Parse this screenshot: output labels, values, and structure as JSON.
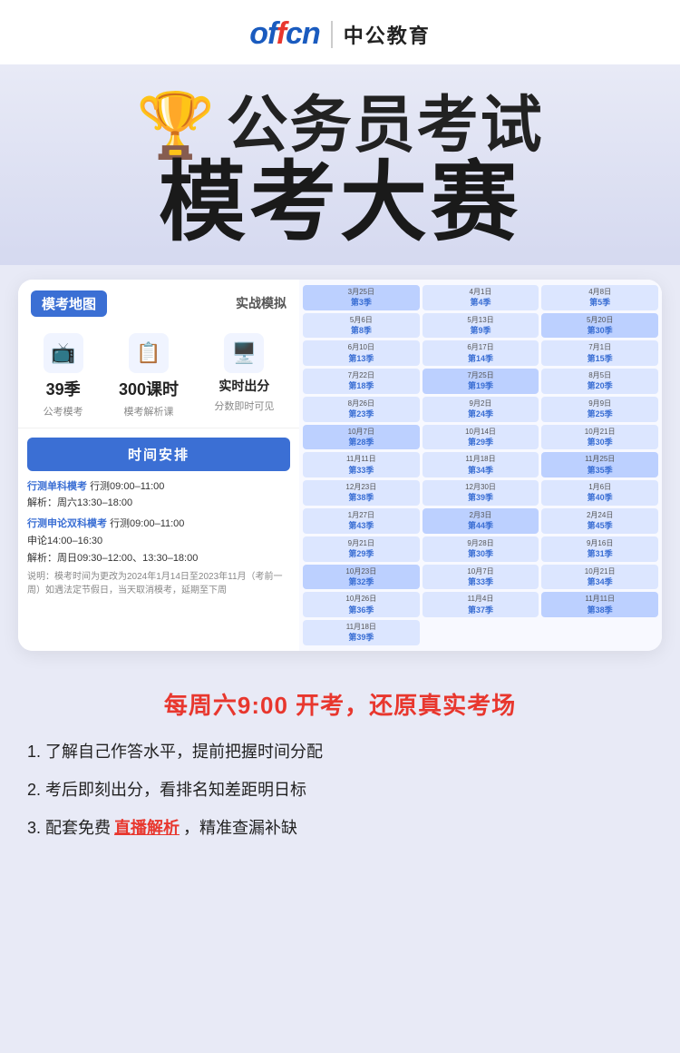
{
  "header": {
    "logo_offcn": "offcn",
    "logo_text": "中公教育"
  },
  "hero": {
    "trophy": "🏆",
    "title1": "公务员考试",
    "title2": "模考大赛"
  },
  "card": {
    "tag": "模考地图",
    "right_label": "实战模拟",
    "stats": [
      {
        "icon": "📺",
        "number": "39季",
        "label": "公考模考"
      },
      {
        "icon": "📋",
        "number": "300课时",
        "label": "模考解析课"
      },
      {
        "icon": "🖥️",
        "number": "实时出分",
        "label": "分数即时可见"
      }
    ],
    "schedule_btn": "时间安排",
    "schedule_items": [
      {
        "link": "行测单科模考",
        "times": "行测09:00–11:00",
        "parse": "解析：周六13:30–18:00"
      },
      {
        "link": "行测申论双科模考",
        "times": "行测09:00–11:00\n申论14:00–16:30",
        "parse": "解析：周日09:30–12:00、13:30–18:00"
      }
    ],
    "note": "说明：模考时间为更改为2024年1月14日至2023年11月（考前一周）如遇法定节假日，当天取消模考，延期至下周"
  },
  "calendar": {
    "cells": [
      {
        "date": "3月25日",
        "season": "第3季"
      },
      {
        "date": "4月1日",
        "season": "第4季"
      },
      {
        "date": "4月8日",
        "season": "第5季"
      },
      {
        "date": "5月6日",
        "season": "第8季"
      },
      {
        "date": "5月13日",
        "season": "第9季"
      },
      {
        "date": "5月20日",
        "season": "第30季"
      },
      {
        "date": "6月10日",
        "season": "第13季"
      },
      {
        "date": "6月17日",
        "season": "第14季"
      },
      {
        "date": "7月1日",
        "season": "第15季"
      },
      {
        "date": "7月22日",
        "season": "第18季"
      },
      {
        "date": "7月25日",
        "season": "第19季"
      },
      {
        "date": "8月5日",
        "season": "第20季"
      },
      {
        "date": "8月26日",
        "season": "第23季"
      },
      {
        "date": "9月2日",
        "season": "第24季"
      },
      {
        "date": "9月9日",
        "season": "第25季"
      },
      {
        "date": "10月7日",
        "season": "第28季"
      },
      {
        "date": "10月14日",
        "season": "第29季"
      },
      {
        "date": "10月21日",
        "season": "第30季"
      },
      {
        "date": "11月11日",
        "season": "第33季"
      },
      {
        "date": "11月18日",
        "season": "第34季"
      },
      {
        "date": "11月25日",
        "season": "第35季"
      },
      {
        "date": "12月23日",
        "season": "第38季"
      },
      {
        "date": "12月30日",
        "season": "第39季"
      },
      {
        "date": "1月6日",
        "season": "第40季"
      },
      {
        "date": "1月27日",
        "season": "第43季"
      },
      {
        "date": "2月3日",
        "season": "第44季"
      },
      {
        "date": "2月24日",
        "season": "第45季"
      },
      {
        "date": "9月21日",
        "season": "第29季"
      },
      {
        "date": "9月28日",
        "season": "第30季"
      },
      {
        "date": "9月16日",
        "season": "第31季"
      },
      {
        "date": "10月23日",
        "season": "第32季"
      },
      {
        "date": "10月7日",
        "season": "第33季"
      },
      {
        "date": "10月21日",
        "season": "第34季"
      },
      {
        "date": "10月26日",
        "season": "第36季"
      },
      {
        "date": "11月4日",
        "season": "第37季"
      },
      {
        "date": "11月11日",
        "season": "第38季"
      },
      {
        "date": "11月18日",
        "season": "第39季"
      }
    ]
  },
  "bottom": {
    "title": "每周六9:00 开考，还原真实考场",
    "features": [
      {
        "text": "1. 了解自己作答水平，提前把握时间分配",
        "link": null
      },
      {
        "text": "2. 考后即刻出分，看排名知差距明日标",
        "link": null
      },
      {
        "text_before": "3. 配套免费",
        "link_text": "直播解析",
        "text_after": "，精准查漏补缺",
        "link": true
      }
    ]
  }
}
